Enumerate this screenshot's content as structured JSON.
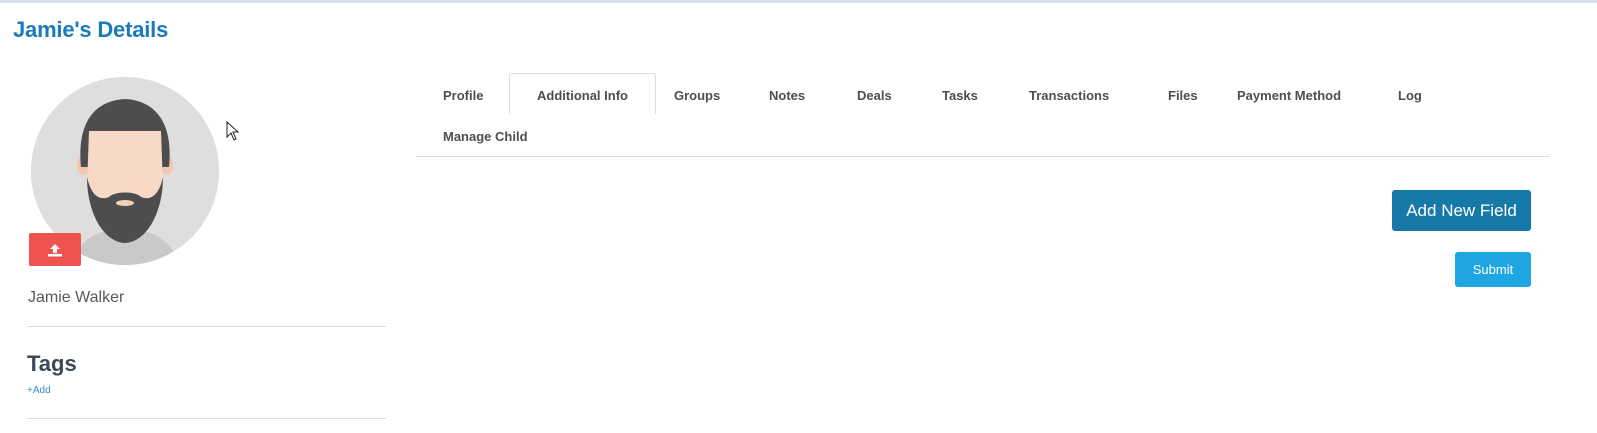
{
  "page": {
    "title": "Jamie's Details"
  },
  "profile": {
    "full_name": "Jamie Walker",
    "avatar_icon": "avatar-placeholder-icon",
    "upload_icon": "upload-icon"
  },
  "tags": {
    "heading": "Tags",
    "add_label": "+Add"
  },
  "tabs": [
    {
      "label": "Profile",
      "active": false
    },
    {
      "label": "Additional Info",
      "active": true
    },
    {
      "label": "Groups",
      "active": false
    },
    {
      "label": "Notes",
      "active": false
    },
    {
      "label": "Deals",
      "active": false
    },
    {
      "label": "Tasks",
      "active": false
    },
    {
      "label": "Transactions",
      "active": false
    },
    {
      "label": "Files",
      "active": false
    },
    {
      "label": "Payment Method",
      "active": false
    },
    {
      "label": "Log",
      "active": false
    },
    {
      "label": "Manage Child",
      "active": false
    }
  ],
  "actions": {
    "add_field_label": "Add New Field",
    "submit_label": "Submit"
  },
  "colors": {
    "brand": "#1a7bb9",
    "primary_button": "#1679a8",
    "submit_button": "#1ea5e2",
    "upload_button": "#ef5350"
  }
}
